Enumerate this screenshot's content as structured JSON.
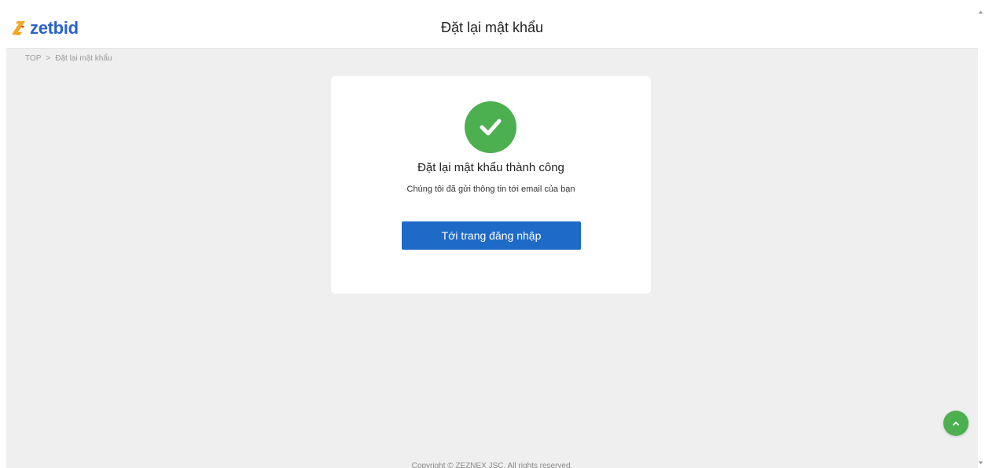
{
  "header": {
    "logo_text": "zetbid",
    "title": "Đặt lại mật khẩu"
  },
  "breadcrumb": {
    "home": "TOP",
    "separator": ">",
    "current": "Đặt lại mật khẩu"
  },
  "card": {
    "icon": "check-icon",
    "title": "Đặt lại mật khẩu thành công",
    "subtitle": "Chúng tôi đã gửi thông tin tới email của bạn",
    "button_label": "Tới trang đăng nhập"
  },
  "footer": {
    "copyright": "Copyright © ZEZNEX JSC. All rights reserved."
  },
  "colors": {
    "brand_blue": "#2962c8",
    "brand_orange": "#f5a623",
    "success_green": "#4caf50",
    "button_blue": "#1e6ac7",
    "background": "#efefef"
  },
  "icons": {
    "back_to_top": "chevron-up-icon"
  }
}
